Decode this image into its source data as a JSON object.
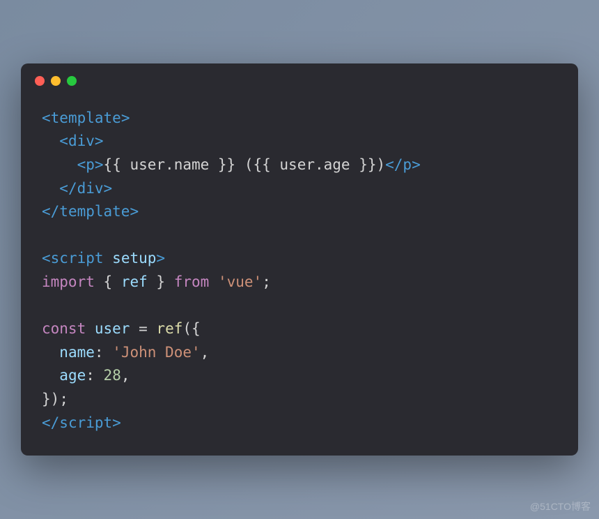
{
  "code": {
    "lines": [
      {
        "indent": 0,
        "tokens": [
          {
            "t": "tag-bracket",
            "v": "<"
          },
          {
            "t": "tag-name",
            "v": "template"
          },
          {
            "t": "tag-bracket",
            "v": ">"
          }
        ]
      },
      {
        "indent": 1,
        "tokens": [
          {
            "t": "tag-bracket",
            "v": "<"
          },
          {
            "t": "tag-name",
            "v": "div"
          },
          {
            "t": "tag-bracket",
            "v": ">"
          }
        ]
      },
      {
        "indent": 2,
        "tokens": [
          {
            "t": "tag-bracket",
            "v": "<"
          },
          {
            "t": "tag-name",
            "v": "p"
          },
          {
            "t": "tag-bracket",
            "v": ">"
          },
          {
            "t": "text",
            "v": "{{ user.name }} ({{ user.age }})"
          },
          {
            "t": "tag-bracket",
            "v": "</"
          },
          {
            "t": "tag-name",
            "v": "p"
          },
          {
            "t": "tag-bracket",
            "v": ">"
          }
        ]
      },
      {
        "indent": 1,
        "tokens": [
          {
            "t": "tag-bracket",
            "v": "</"
          },
          {
            "t": "tag-name",
            "v": "div"
          },
          {
            "t": "tag-bracket",
            "v": ">"
          }
        ]
      },
      {
        "indent": 0,
        "tokens": [
          {
            "t": "tag-bracket",
            "v": "</"
          },
          {
            "t": "tag-name",
            "v": "template"
          },
          {
            "t": "tag-bracket",
            "v": ">"
          }
        ]
      },
      {
        "indent": 0,
        "tokens": []
      },
      {
        "indent": 0,
        "tokens": [
          {
            "t": "tag-bracket",
            "v": "<"
          },
          {
            "t": "tag-name",
            "v": "script"
          },
          {
            "t": "text",
            "v": " "
          },
          {
            "t": "attr-name",
            "v": "setup"
          },
          {
            "t": "tag-bracket",
            "v": ">"
          }
        ]
      },
      {
        "indent": 0,
        "tokens": [
          {
            "t": "keyword",
            "v": "import"
          },
          {
            "t": "text",
            "v": " "
          },
          {
            "t": "brace",
            "v": "{"
          },
          {
            "t": "text",
            "v": " "
          },
          {
            "t": "identifier",
            "v": "ref"
          },
          {
            "t": "text",
            "v": " "
          },
          {
            "t": "brace",
            "v": "}"
          },
          {
            "t": "text",
            "v": " "
          },
          {
            "t": "keyword",
            "v": "from"
          },
          {
            "t": "text",
            "v": " "
          },
          {
            "t": "string",
            "v": "'vue'"
          },
          {
            "t": "punctuation",
            "v": ";"
          }
        ]
      },
      {
        "indent": 0,
        "tokens": []
      },
      {
        "indent": 0,
        "tokens": [
          {
            "t": "keyword",
            "v": "const"
          },
          {
            "t": "text",
            "v": " "
          },
          {
            "t": "identifier",
            "v": "user"
          },
          {
            "t": "text",
            "v": " "
          },
          {
            "t": "punctuation",
            "v": "="
          },
          {
            "t": "text",
            "v": " "
          },
          {
            "t": "function",
            "v": "ref"
          },
          {
            "t": "punctuation",
            "v": "("
          },
          {
            "t": "brace",
            "v": "{"
          }
        ]
      },
      {
        "indent": 1,
        "tokens": [
          {
            "t": "property",
            "v": "name"
          },
          {
            "t": "punctuation",
            "v": ":"
          },
          {
            "t": "text",
            "v": " "
          },
          {
            "t": "string",
            "v": "'John Doe'"
          },
          {
            "t": "punctuation",
            "v": ","
          }
        ]
      },
      {
        "indent": 1,
        "tokens": [
          {
            "t": "property",
            "v": "age"
          },
          {
            "t": "punctuation",
            "v": ":"
          },
          {
            "t": "text",
            "v": " "
          },
          {
            "t": "number",
            "v": "28"
          },
          {
            "t": "punctuation",
            "v": ","
          }
        ]
      },
      {
        "indent": 0,
        "tokens": [
          {
            "t": "brace",
            "v": "}"
          },
          {
            "t": "punctuation",
            "v": ")"
          },
          {
            "t": "punctuation",
            "v": ";"
          }
        ]
      },
      {
        "indent": 0,
        "tokens": [
          {
            "t": "tag-bracket",
            "v": "</"
          },
          {
            "t": "tag-name",
            "v": "script"
          },
          {
            "t": "tag-bracket",
            "v": ">"
          }
        ]
      }
    ]
  },
  "watermark": "@51CTO博客"
}
